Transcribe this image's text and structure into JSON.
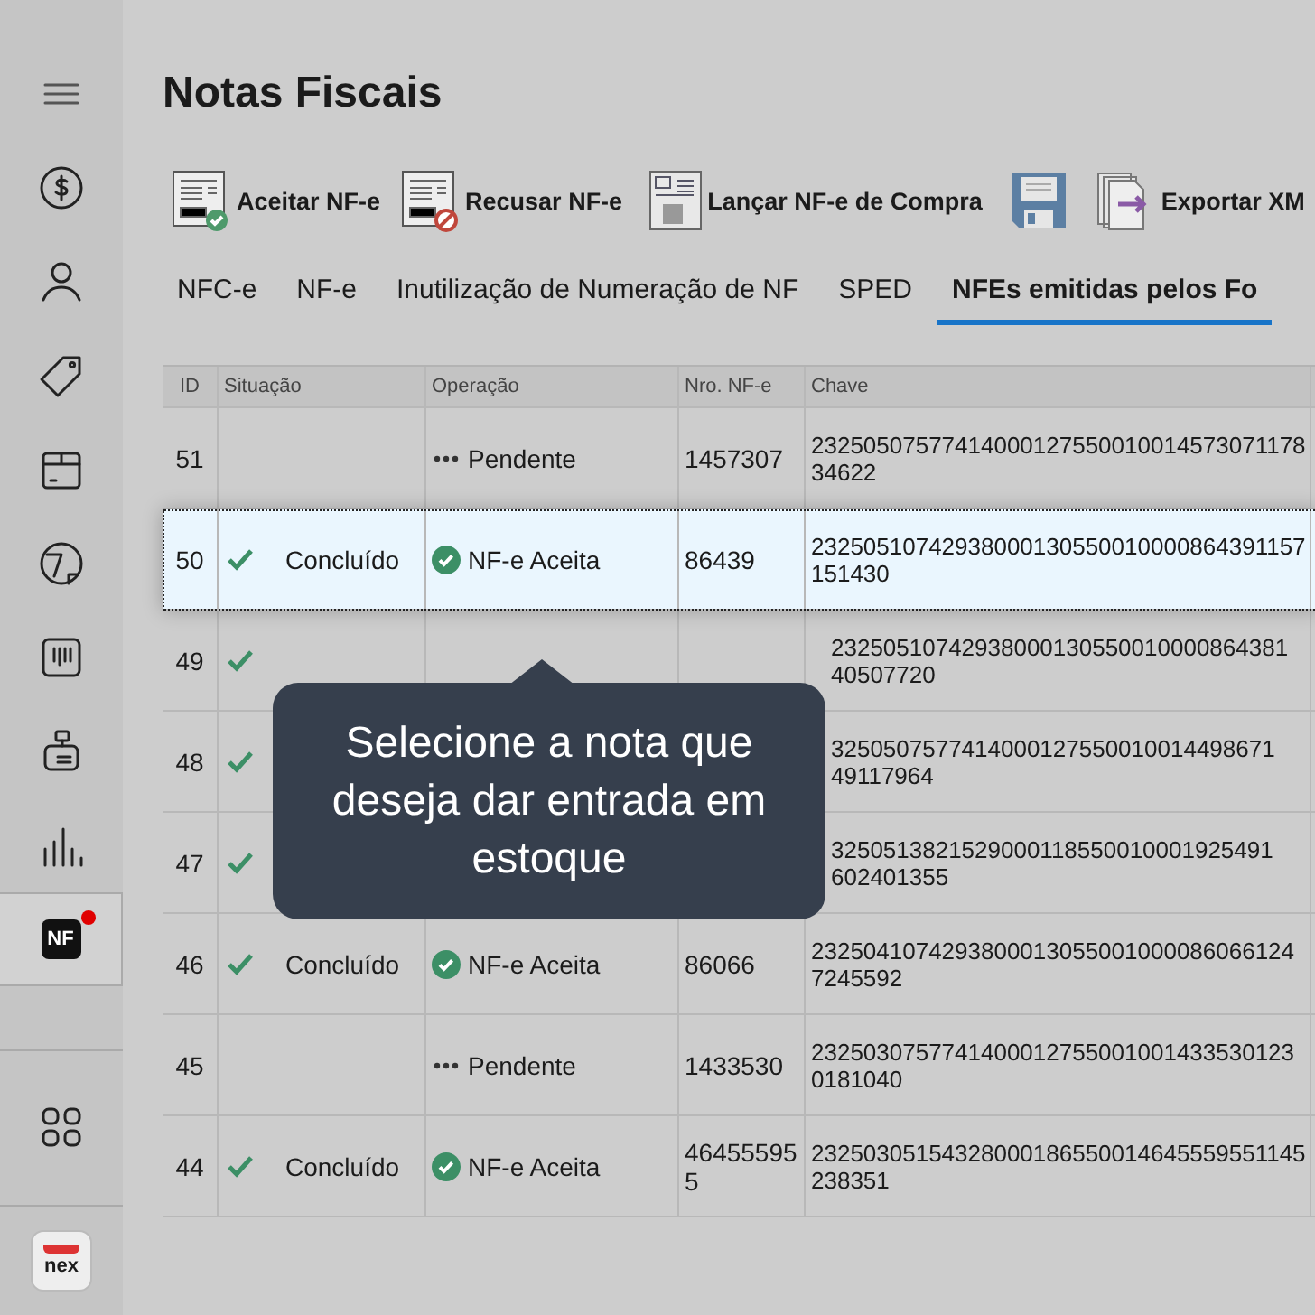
{
  "sidebar": {
    "items": [
      {
        "selected": false
      },
      {
        "selected": false
      },
      {
        "selected": false
      },
      {
        "selected": false
      },
      {
        "selected": false
      },
      {
        "selected": false
      },
      {
        "selected": false
      },
      {
        "selected": false
      },
      {
        "selected": false
      },
      {
        "selected": true,
        "label": "NF",
        "badge": true
      }
    ],
    "bottom": [
      {
        "kind": "grid"
      },
      {
        "kind": "logo",
        "label": "nex"
      }
    ]
  },
  "title": "Notas Fiscais",
  "toolbar": [
    {
      "kind": "text",
      "label": "Aceitar NF-e"
    },
    {
      "kind": "text",
      "label": "Recusar NF-e"
    },
    {
      "kind": "text",
      "label": "Lançar NF-e de Compra"
    },
    {
      "kind": "save"
    },
    {
      "kind": "text",
      "label": "Exportar XM"
    }
  ],
  "tabs": [
    {
      "label": "NFC-e",
      "selected": false
    },
    {
      "label": "NF-e",
      "selected": false
    },
    {
      "label": "Inutilização de Numeração de NF",
      "selected": false
    },
    {
      "label": "SPED",
      "selected": false
    },
    {
      "label": "NFEs emitidas pelos Fo",
      "selected": true
    }
  ],
  "table": {
    "columns": [
      "ID",
      "Situação",
      "Operação",
      "Nro. NF-e",
      "Chave"
    ],
    "rows": [
      {
        "id": "51",
        "done": false,
        "operacao": {
          "kind": "pending",
          "label": "Pendente"
        },
        "nro": "1457307",
        "chave": "2325050757741400012755001001457307117834622",
        "selected": false
      },
      {
        "id": "50",
        "done": true,
        "situacao": "Concluído",
        "operacao": {
          "kind": "accepted",
          "label": "NF-e Aceita"
        },
        "nro": "86439",
        "chave": "23250510742938000130550010000864391157151430",
        "selected": true
      },
      {
        "id": "49",
        "done": true,
        "chave": "23250510742938000130550010000864381",
        "chave_2": "40507720",
        "selected": false
      },
      {
        "id": "48",
        "done": true,
        "chave": "3250507577414000127550010014498671",
        "chave_2": "49117964",
        "selected": false
      },
      {
        "id": "47",
        "done": true,
        "chave": "3250513821529000118550010001925491",
        "chave_2": "602401355",
        "selected": false
      },
      {
        "id": "46",
        "done": true,
        "situacao": "Concluído",
        "operacao": {
          "kind": "accepted",
          "label": "NF-e Aceita"
        },
        "nro": "86066",
        "chave": "23250410742938000130550010000860661247245592",
        "selected": false
      },
      {
        "id": "45",
        "done": false,
        "operacao": {
          "kind": "pending",
          "label": "Pendente"
        },
        "nro": "1433530",
        "chave": "23250307577414000127550010014335301230181040",
        "selected": false
      },
      {
        "id": "44",
        "done": true,
        "situacao": "Concluído",
        "operacao": {
          "kind": "accepted",
          "label": "NF-e Aceita"
        },
        "nro": "464555955",
        "chave": "23250305154328000186550014645559551145238351",
        "selected": false
      }
    ]
  },
  "tooltip": {
    "text": "Selecione a nota que deseja dar entrada em estoque"
  }
}
